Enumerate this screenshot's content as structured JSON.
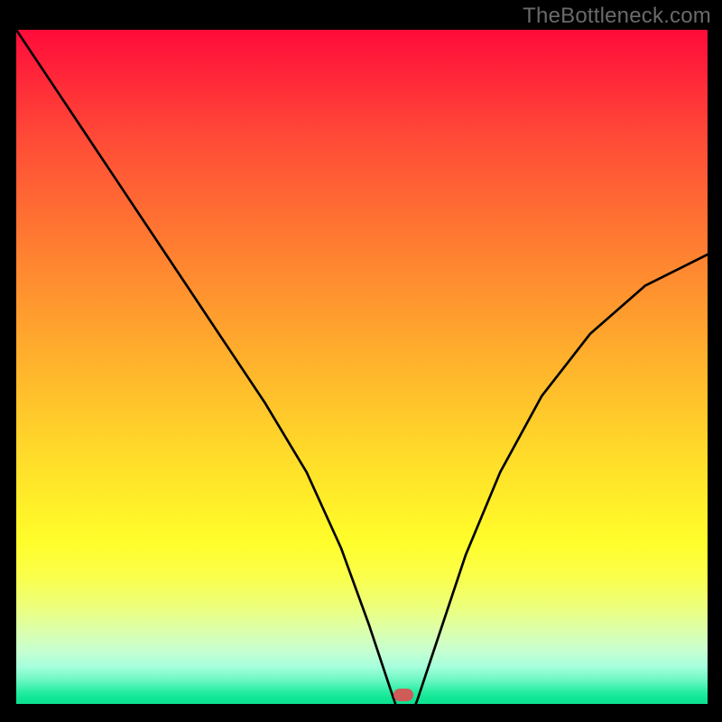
{
  "watermark": "TheBottleneck.com",
  "chart_data": {
    "type": "line",
    "title": "",
    "xlabel": "",
    "ylabel": "",
    "xlim": [
      0,
      100
    ],
    "ylim": [
      0,
      100
    ],
    "series": [
      {
        "name": "bottleneck-curve",
        "x": [
          0,
          6,
          12,
          18,
          24,
          30,
          36,
          42,
          47,
          51,
          54,
          55.5,
          57,
          58,
          61,
          65,
          70,
          76,
          83,
          91,
          100
        ],
        "values": [
          100,
          91,
          82,
          73,
          64,
          55,
          46,
          36,
          25,
          14,
          5,
          0.5,
          0.5,
          3,
          12,
          24,
          36,
          47,
          56,
          63,
          67.5
        ]
      }
    ],
    "marker": {
      "x": 56,
      "y": 1.3
    },
    "colors": {
      "curve": "#000000",
      "marker": "#ce5c59",
      "gradient_top": "#ff0b3a",
      "gradient_bottom": "#0de091"
    }
  }
}
